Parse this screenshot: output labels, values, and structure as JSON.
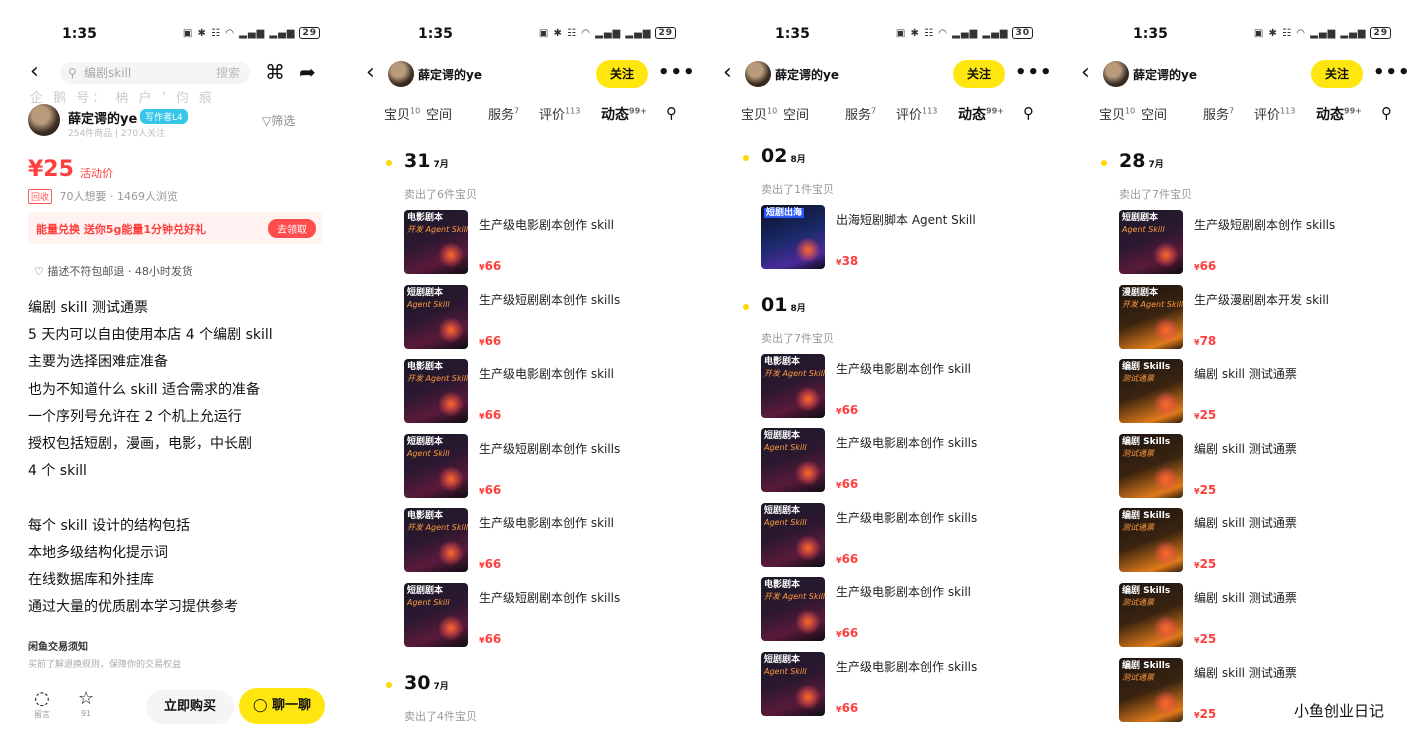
{
  "status_bars": [
    {
      "time": "1:35",
      "battery": "29"
    },
    {
      "time": "1:35",
      "battery": "29"
    },
    {
      "time": "1:35",
      "battery": "30"
    },
    {
      "time": "1:35",
      "battery": "29"
    }
  ],
  "detail": {
    "search_placeholder": "编剧skill",
    "search_button": "搜索",
    "watermark": "企 鹅 号： 柟 户 ’ 伨 痕",
    "seller_name": "薛定谔的ye",
    "seller_badge": "写作者L4",
    "seller_meta": "254件商品 | 270人关注",
    "filter_label": "筛选",
    "price": "¥25",
    "price_tag": "活动价",
    "tag_box": "回收",
    "stats": "70人想要 · 1469人浏览",
    "promo_text": "能量兑换  送你5g能量1分钟兑好礼",
    "promo_button": "去领取",
    "ship_text": "描述不符包邮退 · 48小时发货",
    "description": "编剧 skill 测试通票\n5 天内可以自由使用本店 4 个编剧 skill\n主要为选择困难症准备\n也为不知道什么 skill 适合需求的准备\n一个序列号允许在 2 个机上允运行\n授权包括短剧，漫画，电影，中长剧\n4 个 skill\n\n每个 skill 设计的结构包括\n本地多级结构化提示词\n在线数据库和外挂库\n通过大量的优质剧本学习提供参考",
    "notice_title": "闲鱼交易须知",
    "notice_sub": "买前了解退换规则，保障你的交易权益",
    "bottom": {
      "comment_label": "留言",
      "fav_count": "91",
      "buy_label": "立即购买",
      "chat_label": "聊一聊"
    }
  },
  "shop": {
    "name": "薛定谔的ye",
    "follow_label": "关注",
    "tabs": [
      {
        "label": "宝贝",
        "count": "10"
      },
      {
        "label": "空间",
        "count": ""
      },
      {
        "label": "服务",
        "count": "7"
      },
      {
        "label": "评价",
        "count": "113"
      },
      {
        "label": "动态",
        "count": "99+"
      }
    ]
  },
  "feeds": [
    {
      "groups": [
        {
          "day": "31",
          "month": "7月",
          "sold": "卖出了6件宝贝",
          "items": [
            {
              "title": "生产级电影剧本创作 skill",
              "price": "66",
              "thumb_line1": "电影剧本",
              "thumb_line2": "开发 Agent Skill"
            },
            {
              "title": "生产级短剧剧本创作 skills",
              "price": "66",
              "thumb_line1": "短剧剧本",
              "thumb_line2": "Agent Skill"
            },
            {
              "title": "生产级电影剧本创作 skill",
              "price": "66",
              "thumb_line1": "电影剧本",
              "thumb_line2": "开发 Agent Skill"
            },
            {
              "title": "生产级短剧剧本创作 skills",
              "price": "66",
              "thumb_line1": "短剧剧本",
              "thumb_line2": "Agent Skill"
            },
            {
              "title": "生产级电影剧本创作 skill",
              "price": "66",
              "thumb_line1": "电影剧本",
              "thumb_line2": "开发 Agent Skill"
            },
            {
              "title": "生产级短剧剧本创作 skills",
              "price": "66",
              "thumb_line1": "短剧剧本",
              "thumb_line2": "Agent Skill"
            }
          ]
        },
        {
          "day": "30",
          "month": "7月",
          "sold": "卖出了4件宝贝",
          "items": []
        }
      ]
    },
    {
      "groups": [
        {
          "day": "02",
          "month": "8月",
          "sold": "卖出了1件宝贝",
          "items": [
            {
              "title": "出海短剧脚本 Agent Skill",
              "price": "38",
              "thumb_line1": "短剧出海",
              "thumb_line2": ""
            }
          ]
        },
        {
          "day": "01",
          "month": "8月",
          "sold": "卖出了7件宝贝",
          "items": [
            {
              "title": "生产级电影剧本创作 skill",
              "price": "66",
              "thumb_line1": "电影剧本",
              "thumb_line2": "开发 Agent Skill"
            },
            {
              "title": "生产级电影剧本创作 skills",
              "price": "66",
              "thumb_line1": "短剧剧本",
              "thumb_line2": "Agent Skill"
            },
            {
              "title": "生产级电影剧本创作 skills",
              "price": "66",
              "thumb_line1": "短剧剧本",
              "thumb_line2": "Agent Skill"
            },
            {
              "title": "生产级电影剧本创作 skill",
              "price": "66",
              "thumb_line1": "电影剧本",
              "thumb_line2": "开发 Agent Skill"
            },
            {
              "title": "生产级电影剧本创作 skills",
              "price": "66",
              "thumb_line1": "短剧剧本",
              "thumb_line2": "Agent Skill"
            }
          ]
        }
      ]
    },
    {
      "groups": [
        {
          "day": "28",
          "month": "7月",
          "sold": "卖出了7件宝贝",
          "items": [
            {
              "title": "生产级短剧剧本创作 skills",
              "price": "66",
              "thumb_line1": "短剧剧本",
              "thumb_line2": "Agent Skill"
            },
            {
              "title": "生产级漫剧剧本开发 skill",
              "price": "78",
              "thumb_line1": "漫剧剧本",
              "thumb_line2": "开发 Agent Skill"
            },
            {
              "title": "编剧 skill 测试通票",
              "price": "25",
              "thumb_line1": "编剧 Skills",
              "thumb_line2": "测试通票"
            },
            {
              "title": "编剧 skill 测试通票",
              "price": "25",
              "thumb_line1": "编剧 Skills",
              "thumb_line2": "测试通票"
            },
            {
              "title": "编剧 skill 测试通票",
              "price": "25",
              "thumb_line1": "编剧 Skills",
              "thumb_line2": "测试通票"
            },
            {
              "title": "编剧 skill 测试通票",
              "price": "25",
              "thumb_line1": "编剧 Skills",
              "thumb_line2": "测试通票"
            },
            {
              "title": "编剧 skill 测试通票",
              "price": "25",
              "thumb_line1": "编剧 Skills",
              "thumb_line2": "测试通票"
            }
          ]
        }
      ]
    }
  ],
  "credit": "小鱼创业日记",
  "colors": {
    "accent": "#ffe60f",
    "price": "#ff3e3e",
    "badge": "#35c7e8"
  }
}
